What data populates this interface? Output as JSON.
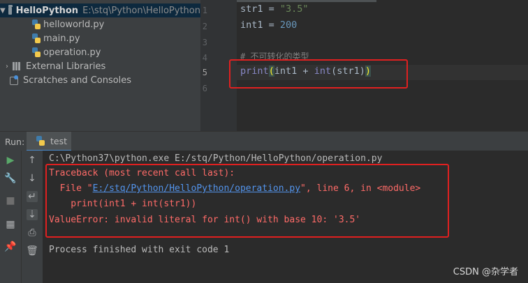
{
  "project": {
    "name": "HelloPython",
    "path": "E:\\stq\\Python\\HelloPython",
    "files": [
      "helloworld.py",
      "main.py",
      "operation.py"
    ],
    "external_libraries": "External Libraries",
    "scratches": "Scratches and Consoles"
  },
  "editor": {
    "line_numbers": [
      "1",
      "2",
      "3",
      "4",
      "5",
      "6"
    ],
    "lines": {
      "l1_var": "str1 = ",
      "l1_val": "\"3.5\"",
      "l2_var": "int1 = ",
      "l2_val": "200",
      "l4_comment": "# 不可转化的类型",
      "l5_print": "print",
      "l5_open": "(",
      "l5_mid": "int1 + ",
      "l5_int": "int",
      "l5_args": "(str1)",
      "l5_close": ")"
    }
  },
  "run": {
    "label": "Run:",
    "tab": "test"
  },
  "console": {
    "cmd": "C:\\Python37\\python.exe E:/stq/Python/HelloPython/operation.py",
    "traceback": "Traceback (most recent call last):",
    "file_prefix": "  File \"",
    "file_link": "E:/stq/Python/HelloPython/operation.py",
    "file_suffix": "\", line 6, in <module>",
    "code": "    print(int1 + int(str1))",
    "error": "ValueError: invalid literal for int() with base 10: '3.5'",
    "finished": "Process finished with exit code 1"
  },
  "watermark": "CSDN @杂学者",
  "colors": {
    "highlight_box": "#e02020",
    "error_text": "#ff6b68",
    "link": "#5394ec"
  }
}
